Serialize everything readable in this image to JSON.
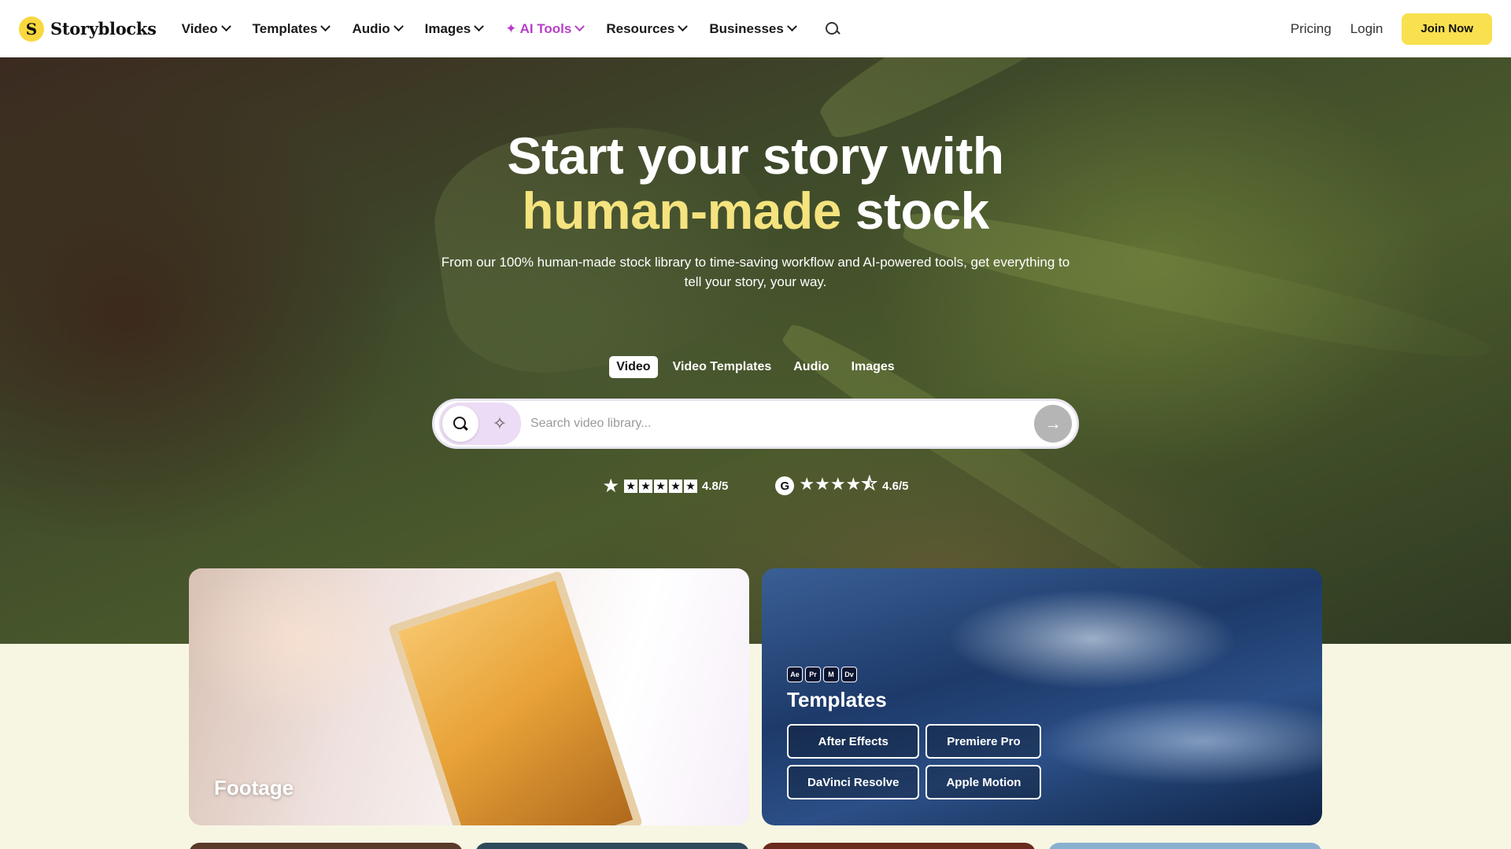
{
  "nav": {
    "logo_text": "Storyblocks",
    "logo_mark": "S",
    "items": [
      {
        "label": "Video",
        "ai": false
      },
      {
        "label": "Templates",
        "ai": false
      },
      {
        "label": "Audio",
        "ai": false
      },
      {
        "label": "Images",
        "ai": false
      },
      {
        "label": "✦ AI Tools",
        "ai": true
      },
      {
        "label": "Resources",
        "ai": false
      },
      {
        "label": "Businesses",
        "ai": false
      }
    ],
    "pricing": "Pricing",
    "login": "Login",
    "join": "Join Now"
  },
  "hero": {
    "title_line1": "Start your story with",
    "title_highlight": "human-made",
    "title_rest": "stock",
    "subtitle": "From our 100% human-made stock library to time-saving workflow and AI-powered tools, get everything to tell your story, your way.",
    "tabs": [
      {
        "label": "Video",
        "active": true
      },
      {
        "label": "Video Templates",
        "active": false
      },
      {
        "label": "Audio",
        "active": false
      },
      {
        "label": "Images",
        "active": false
      }
    ],
    "search": {
      "placeholder": "Search video library..."
    },
    "ratings": {
      "trustpilot_score": "4.8/5",
      "g2_score": "4.6/5"
    }
  },
  "cards": {
    "footage_title": "Footage",
    "templates_title": "Templates",
    "app_icons": [
      "Ae",
      "Pr",
      "M",
      "Dv"
    ],
    "template_buttons": [
      "After Effects",
      "Premiere Pro",
      "DaVinci Resolve",
      "Apple Motion"
    ]
  },
  "colors": {
    "accent_yellow": "#f9e04f",
    "highlight_text": "#f4e37e",
    "ai_purple": "#b63fc6"
  }
}
